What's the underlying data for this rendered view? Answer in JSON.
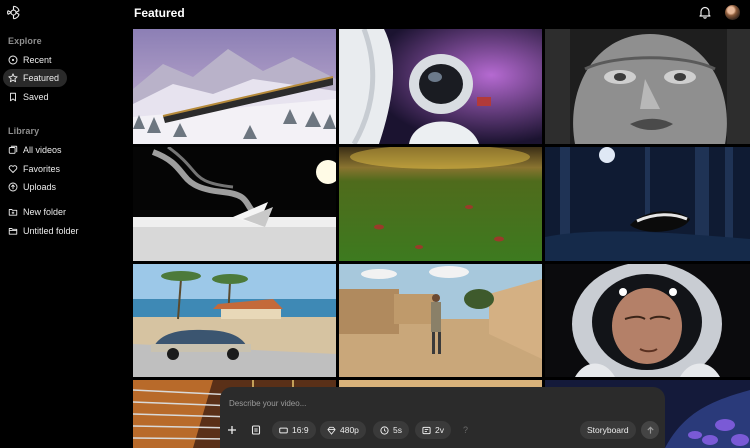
{
  "app": {
    "page_title": "Featured"
  },
  "sidebar": {
    "explore_label": "Explore",
    "explore_items": [
      {
        "label": "Recent",
        "icon": "clock-icon"
      },
      {
        "label": "Featured",
        "icon": "star-icon",
        "active": true
      },
      {
        "label": "Saved",
        "icon": "bookmark-icon"
      }
    ],
    "library_label": "Library",
    "library_items": [
      {
        "label": "All videos",
        "icon": "videos-icon"
      },
      {
        "label": "Favorites",
        "icon": "heart-icon"
      },
      {
        "label": "Uploads",
        "icon": "upload-icon"
      },
      {
        "label": "New folder",
        "icon": "folder-plus-icon"
      },
      {
        "label": "Untitled folder",
        "icon": "folder-icon"
      }
    ]
  },
  "header": {
    "notifications_icon": "bell-icon",
    "avatar_icon": "avatar-icon"
  },
  "grid": {
    "tiles": [
      {
        "name": "snowy-mountain-train"
      },
      {
        "name": "astronaut-with-horse"
      },
      {
        "name": "stone-face-statue"
      },
      {
        "name": "paper-boat-smoke"
      },
      {
        "name": "grass-field-sunset"
      },
      {
        "name": "skunk-night-forest"
      },
      {
        "name": "beach-vintage-car"
      },
      {
        "name": "desert-village-street"
      },
      {
        "name": "astronaut-closeup"
      },
      {
        "name": "guitar-strings"
      },
      {
        "name": "sand-dune"
      },
      {
        "name": "purple-flowers-night"
      }
    ]
  },
  "composer": {
    "placeholder": "Describe your video...",
    "aspect_ratio": "16:9",
    "resolution": "480p",
    "duration": "5s",
    "variations": "2v",
    "help": "?",
    "storyboard_label": "Storyboard"
  },
  "colors": {
    "background": "#000000",
    "composer": "#2b2b2b",
    "chip": "#3a3a3a",
    "active_nav": "#2a2a2a"
  }
}
